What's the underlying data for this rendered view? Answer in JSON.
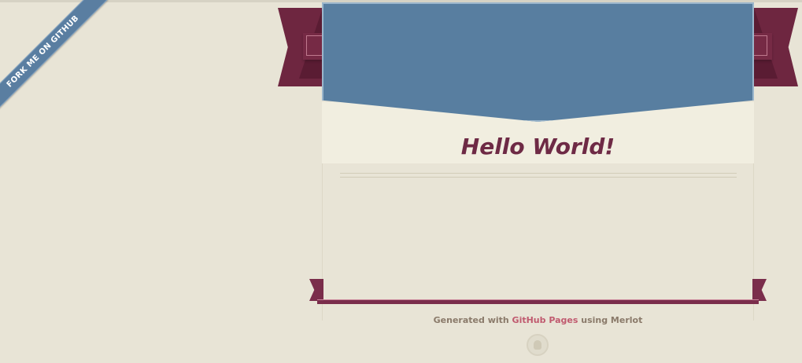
{
  "fork_ribbon": {
    "label": "FORK ME ON GITHUB"
  },
  "header": {
    "title": "Hello World!"
  },
  "footer": {
    "prefix": "Generated with ",
    "link_label": "GitHub Pages",
    "suffix": " using Merlot"
  },
  "icons": {
    "footer_logo": "octocat-icon"
  },
  "colors": {
    "background": "#e8e4d6",
    "header_blue": "#587ea0",
    "ribbon_maroon": "#762a45",
    "title": "#6e2a45",
    "link": "#c05a6f"
  }
}
